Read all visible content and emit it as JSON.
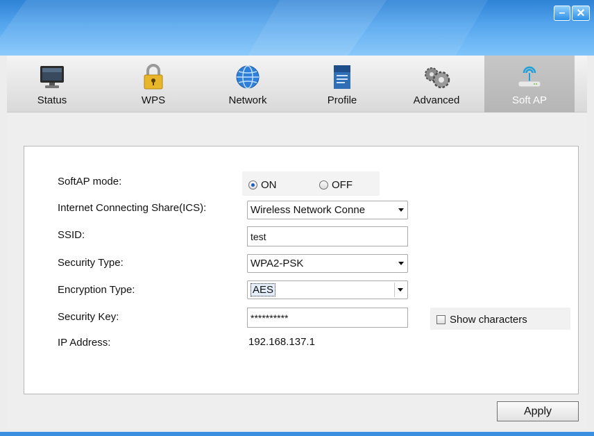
{
  "window": {
    "minimize_label": "–",
    "close_label": "✕",
    "accent_color": "#3b8fe0"
  },
  "tabs": [
    {
      "label": "Status",
      "icon": "monitor-icon",
      "active": false
    },
    {
      "label": "WPS",
      "icon": "lock-icon",
      "active": false
    },
    {
      "label": "Network",
      "icon": "globe-icon",
      "active": false
    },
    {
      "label": "Profile",
      "icon": "document-icon",
      "active": false
    },
    {
      "label": "Advanced",
      "icon": "gears-icon",
      "active": false
    },
    {
      "label": "Soft AP",
      "icon": "wireless-router-icon",
      "active": true
    }
  ],
  "form": {
    "softap_mode_label": "SoftAP mode:",
    "radio_on": "ON",
    "radio_off": "OFF",
    "softap_mode_value": "ON",
    "ics_label": "Internet Connecting Share(ICS):",
    "ics_value": "Wireless Network Conne",
    "ssid_label": "SSID:",
    "ssid_value": "test",
    "security_type_label": "Security Type:",
    "security_type_value": "WPA2-PSK",
    "encryption_type_label": "Encryption Type:",
    "encryption_type_value": "AES",
    "security_key_label": "Security Key:",
    "security_key_value": "**********",
    "show_characters_label": "Show characters",
    "ip_address_label": "IP Address:",
    "ip_address_value": "192.168.137.1"
  },
  "actions": {
    "apply_label": "Apply"
  }
}
